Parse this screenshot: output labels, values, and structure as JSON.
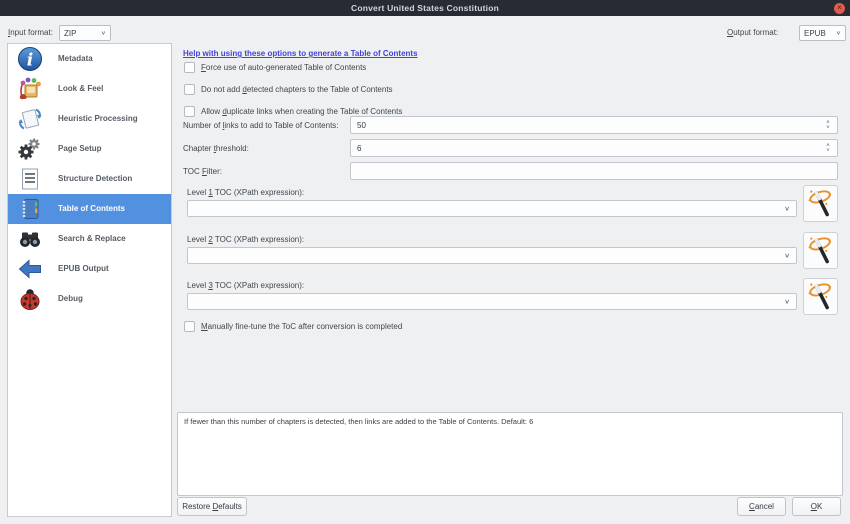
{
  "window": {
    "title": "Convert United States Constitution",
    "close_icon": "×"
  },
  "colors": {
    "accent": "#5291e0",
    "link": "#4343d9",
    "titlebar": "#262b34",
    "close_button": "#e15a4f"
  },
  "format_bar": {
    "input_label": {
      "pre": "",
      "key": "I",
      "post": "nput format:"
    },
    "input_value": "ZIP",
    "output_label": {
      "pre": "",
      "key": "O",
      "post": "utput format:"
    },
    "output_value": "EPUB"
  },
  "sidebar": {
    "items": [
      {
        "label": "Metadata",
        "icon": "info-icon",
        "selected": false
      },
      {
        "label": "Look & Feel",
        "icon": "look-feel-icon",
        "selected": false
      },
      {
        "label": "Heuristic Processing",
        "icon": "heuristic-processing-icon",
        "selected": false
      },
      {
        "label": "Page Setup",
        "icon": "page-setup-icon",
        "selected": false
      },
      {
        "label": "Structure Detection",
        "icon": "structure-detection-icon",
        "selected": false
      },
      {
        "label": "Table of Contents",
        "icon": "toc-icon",
        "selected": true
      },
      {
        "label": "Search & Replace",
        "icon": "search-replace-icon",
        "selected": false
      },
      {
        "label": "EPUB Output",
        "icon": "epub-output-icon",
        "selected": false
      },
      {
        "label": "Debug",
        "icon": "debug-icon",
        "selected": false
      }
    ]
  },
  "main": {
    "help_link": "Help with using these options to generate a Table of Contents",
    "checkboxes": [
      {
        "pre": "",
        "key": "F",
        "post": "orce use of auto-generated Table of Contents",
        "checked": false
      },
      {
        "pre": "Do not add ",
        "key": "d",
        "post": "etected chapters to the Table of Contents",
        "checked": false
      },
      {
        "pre": "Allow ",
        "key": "d",
        "post": "uplicate links when creating the Table of Contents",
        "checked": false
      }
    ],
    "number_of_links": {
      "label": {
        "pre": "Number of ",
        "key": "l",
        "post": "inks to add to Table of Contents:"
      },
      "value": "50"
    },
    "chapter_threshold": {
      "label": {
        "pre": "Chapter ",
        "key": "t",
        "post": "hreshold:"
      },
      "value": "6"
    },
    "toc_filter": {
      "label": {
        "pre": "TOC ",
        "key": "F",
        "post": "ilter:"
      },
      "value": ""
    },
    "levels": [
      {
        "label": {
          "pre": "Level ",
          "key": "1",
          "post": " TOC (XPath expression):"
        },
        "value": ""
      },
      {
        "label": {
          "pre": "Level ",
          "key": "2",
          "post": " TOC (XPath expression):"
        },
        "value": ""
      },
      {
        "label": {
          "pre": "Level ",
          "key": "3",
          "post": " TOC (XPath expression):"
        },
        "value": ""
      }
    ],
    "manual_checkbox": {
      "pre": "",
      "key": "M",
      "post": "anually fine-tune the ToC after conversion is completed",
      "checked": false
    },
    "help_text": "If fewer than this number of chapters is detected, then links are added to the Table of Contents. Default: 6"
  },
  "footer": {
    "restore_defaults": {
      "pre": "Restore ",
      "key": "D",
      "post": "efaults"
    },
    "cancel": {
      "pre": "",
      "key": "C",
      "post": "ancel"
    },
    "ok": {
      "pre": "",
      "key": "O",
      "post": "K"
    }
  }
}
